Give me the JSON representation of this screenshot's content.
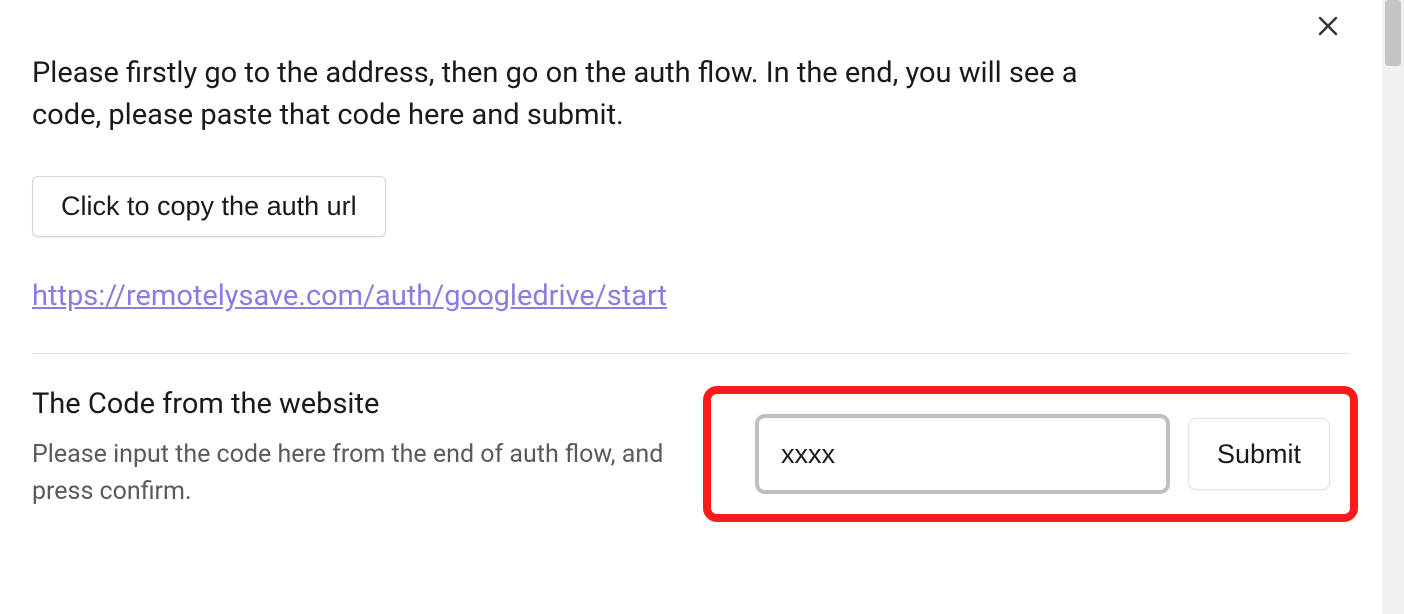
{
  "modal": {
    "instructions": "Please firstly go to the address, then go on the auth flow. In the end, you will see a code, please paste that code here and submit.",
    "copy_button_label": "Click to copy the auth url",
    "auth_url": "https://remotelysave.com/auth/googledrive/start",
    "code_section": {
      "heading": "The Code from the website",
      "help": "Please input the code here from the end of auth flow, and press confirm.",
      "input_value": "xxxx",
      "submit_label": "Submit"
    }
  }
}
